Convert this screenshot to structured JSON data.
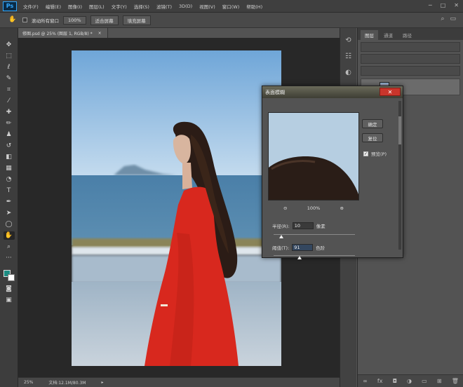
{
  "app": {
    "logo": "Ps"
  },
  "menu": {
    "items": [
      "文件(F)",
      "编辑(E)",
      "图像(I)",
      "图层(L)",
      "文字(Y)",
      "选择(S)",
      "滤镜(T)",
      "3D(D)",
      "视图(V)",
      "窗口(W)",
      "帮助(H)"
    ]
  },
  "options_bar": {
    "scroll_all_label": "滚动所有窗口",
    "zoom_value": "100%",
    "fit_screen": "适合屏幕",
    "fill_screen": "填充屏幕"
  },
  "document": {
    "tab_title": "修图.psd @ 25% (图层 1, RGB/8) *",
    "zoom_status": "25%",
    "file_info": "文档:12.1M/80.3M"
  },
  "panel": {
    "tabs": [
      "图层",
      "通道",
      "路径"
    ]
  },
  "dialog": {
    "title": "表面模糊",
    "ok": "确定",
    "reset": "复位",
    "preview_label": "预览(P)",
    "zoom_percent": "100%",
    "radius_label": "半径(R):",
    "radius_value": "10",
    "radius_unit": "像素",
    "threshold_label": "阈值(T):",
    "threshold_value": "91",
    "threshold_unit": "色阶"
  },
  "colors": {
    "foreground": "#1c8c82",
    "background": "#ffffff",
    "dress": "#d8281e"
  },
  "icons": [
    "move-icon",
    "marquee-icon",
    "lasso-icon",
    "quick-select-icon",
    "crop-icon",
    "eyedropper-icon",
    "healing-icon",
    "brush-icon",
    "stamp-icon",
    "history-brush-icon",
    "eraser-icon",
    "gradient-icon",
    "blur-icon",
    "dodge-icon",
    "pen-icon",
    "type-icon",
    "path-select-icon",
    "shape-icon",
    "hand-icon",
    "zoom-icon"
  ]
}
